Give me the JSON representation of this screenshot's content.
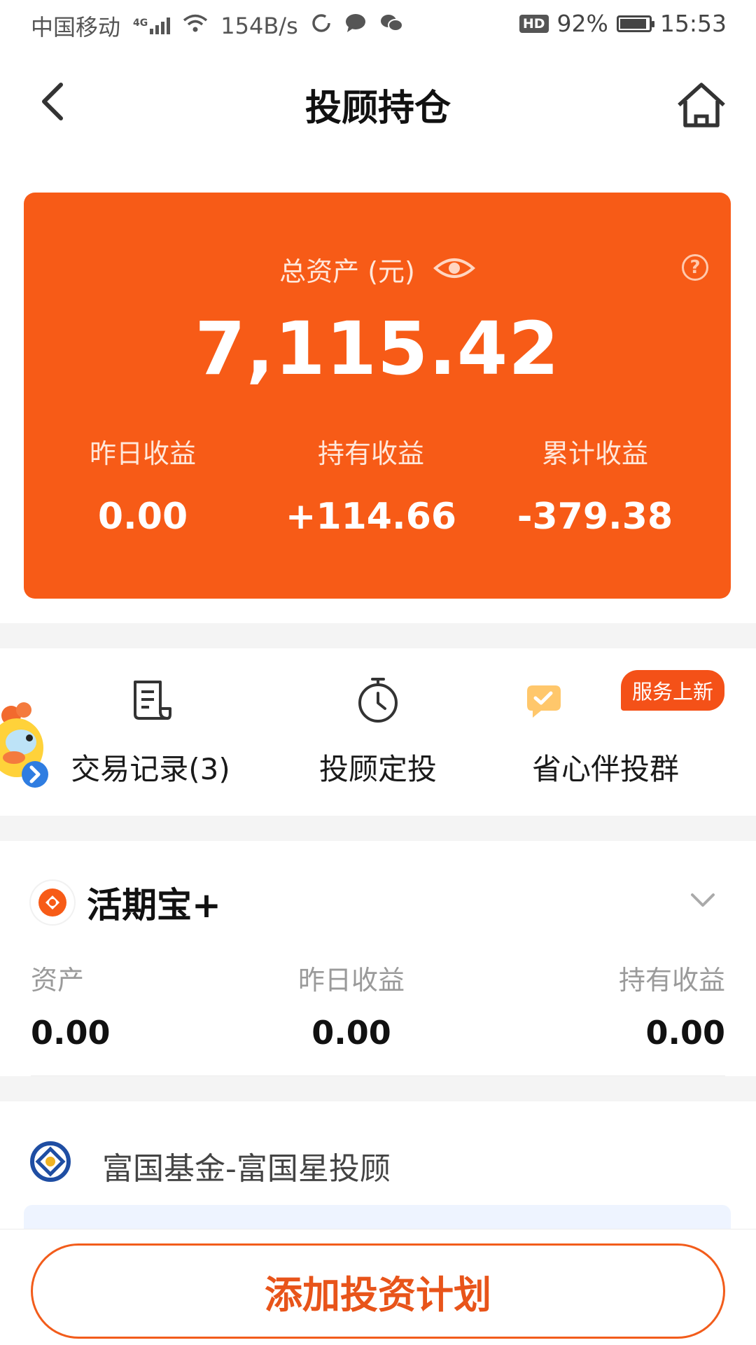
{
  "status_bar": {
    "carrier": "中国移动",
    "network": "4G",
    "speed": "154B/s",
    "hd": "HD",
    "battery": "92%",
    "battery_level": 0.92,
    "time": "15:53"
  },
  "nav": {
    "title": "投顾持仓"
  },
  "summary": {
    "total_label": "总资产 (元)",
    "total_value": "7,115.42",
    "help_glyph": "?",
    "stats": [
      {
        "label": "昨日收益",
        "value": "0.00"
      },
      {
        "label": "持有收益",
        "value": "+114.66"
      },
      {
        "label": "累计收益",
        "value": "-379.38"
      }
    ]
  },
  "actions": [
    {
      "label": "交易记录(3)",
      "icon": "receipt-icon"
    },
    {
      "label": "投顾定投",
      "icon": "clock-icon"
    },
    {
      "label": "省心伴投群",
      "icon": "chat-icon",
      "badge": "服务上新"
    }
  ],
  "product": {
    "name": "活期宝+",
    "columns": [
      {
        "label": "资产",
        "value": "0.00"
      },
      {
        "label": "昨日收益",
        "value": "0.00"
      },
      {
        "label": "持有收益",
        "value": "0.00"
      }
    ]
  },
  "provider": {
    "name": "富国基金-富国星投顾"
  },
  "bottom": {
    "add_plan_label": "添加投资计划"
  },
  "colors": {
    "accent": "#f75b17",
    "button_text": "#e8541a"
  }
}
